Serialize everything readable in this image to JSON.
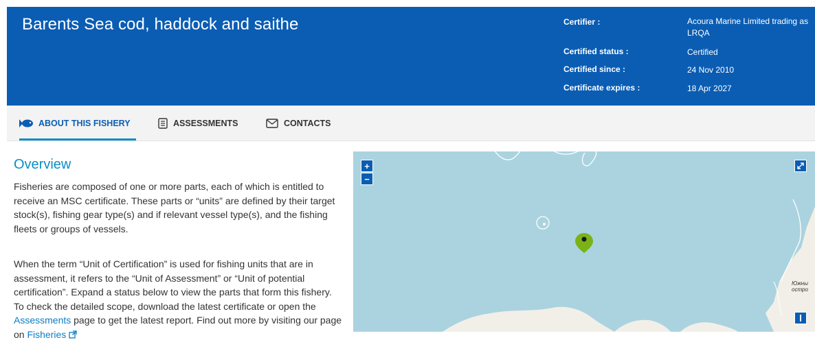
{
  "header": {
    "title": "Barents Sea cod, haddock and saithe",
    "meta": [
      {
        "label": "Certifier :",
        "value": "Acoura Marine Limited trading as LRQA"
      },
      {
        "label": "Certified status :",
        "value": "Certified"
      },
      {
        "label": "Certified since :",
        "value": "24 Nov 2010"
      },
      {
        "label": "Certificate expires :",
        "value": "18 Apr 2027"
      }
    ]
  },
  "tabs": [
    {
      "label": "ABOUT THIS FISHERY",
      "icon": "fish-icon",
      "active": true
    },
    {
      "label": "ASSESSMENTS",
      "icon": "document-icon",
      "active": false
    },
    {
      "label": "CONTACTS",
      "icon": "envelope-icon",
      "active": false
    }
  ],
  "overview": {
    "title": "Overview",
    "p1": "Fisheries are composed of one or more parts, each of which is entitled to receive an MSC certificate. These parts or “units” are defined by their target stock(s), fishing gear type(s) and if relevant vessel type(s), and the fishing fleets or groups of vessels.",
    "p2_before": "When the term “Unit of Certification” is used for fishing units that are in assessment, it refers to the “Unit of Assessment” or “Unit of potential certification”. Expand a status below to view the parts that form this fishery. To check the detailed scope, download the latest certificate or open the ",
    "p2_link1": "Assessments",
    "p2_middle": " page to get the latest report. Find out more by visiting our page on ",
    "p2_link2": "Fisheries"
  },
  "map": {
    "zoom_in": "+",
    "zoom_out": "−",
    "label_line1": "Южны",
    "label_line2": "остро",
    "colors": {
      "water": "#aad3df",
      "land": "#f2efe9",
      "marker": "#7ab317"
    }
  }
}
